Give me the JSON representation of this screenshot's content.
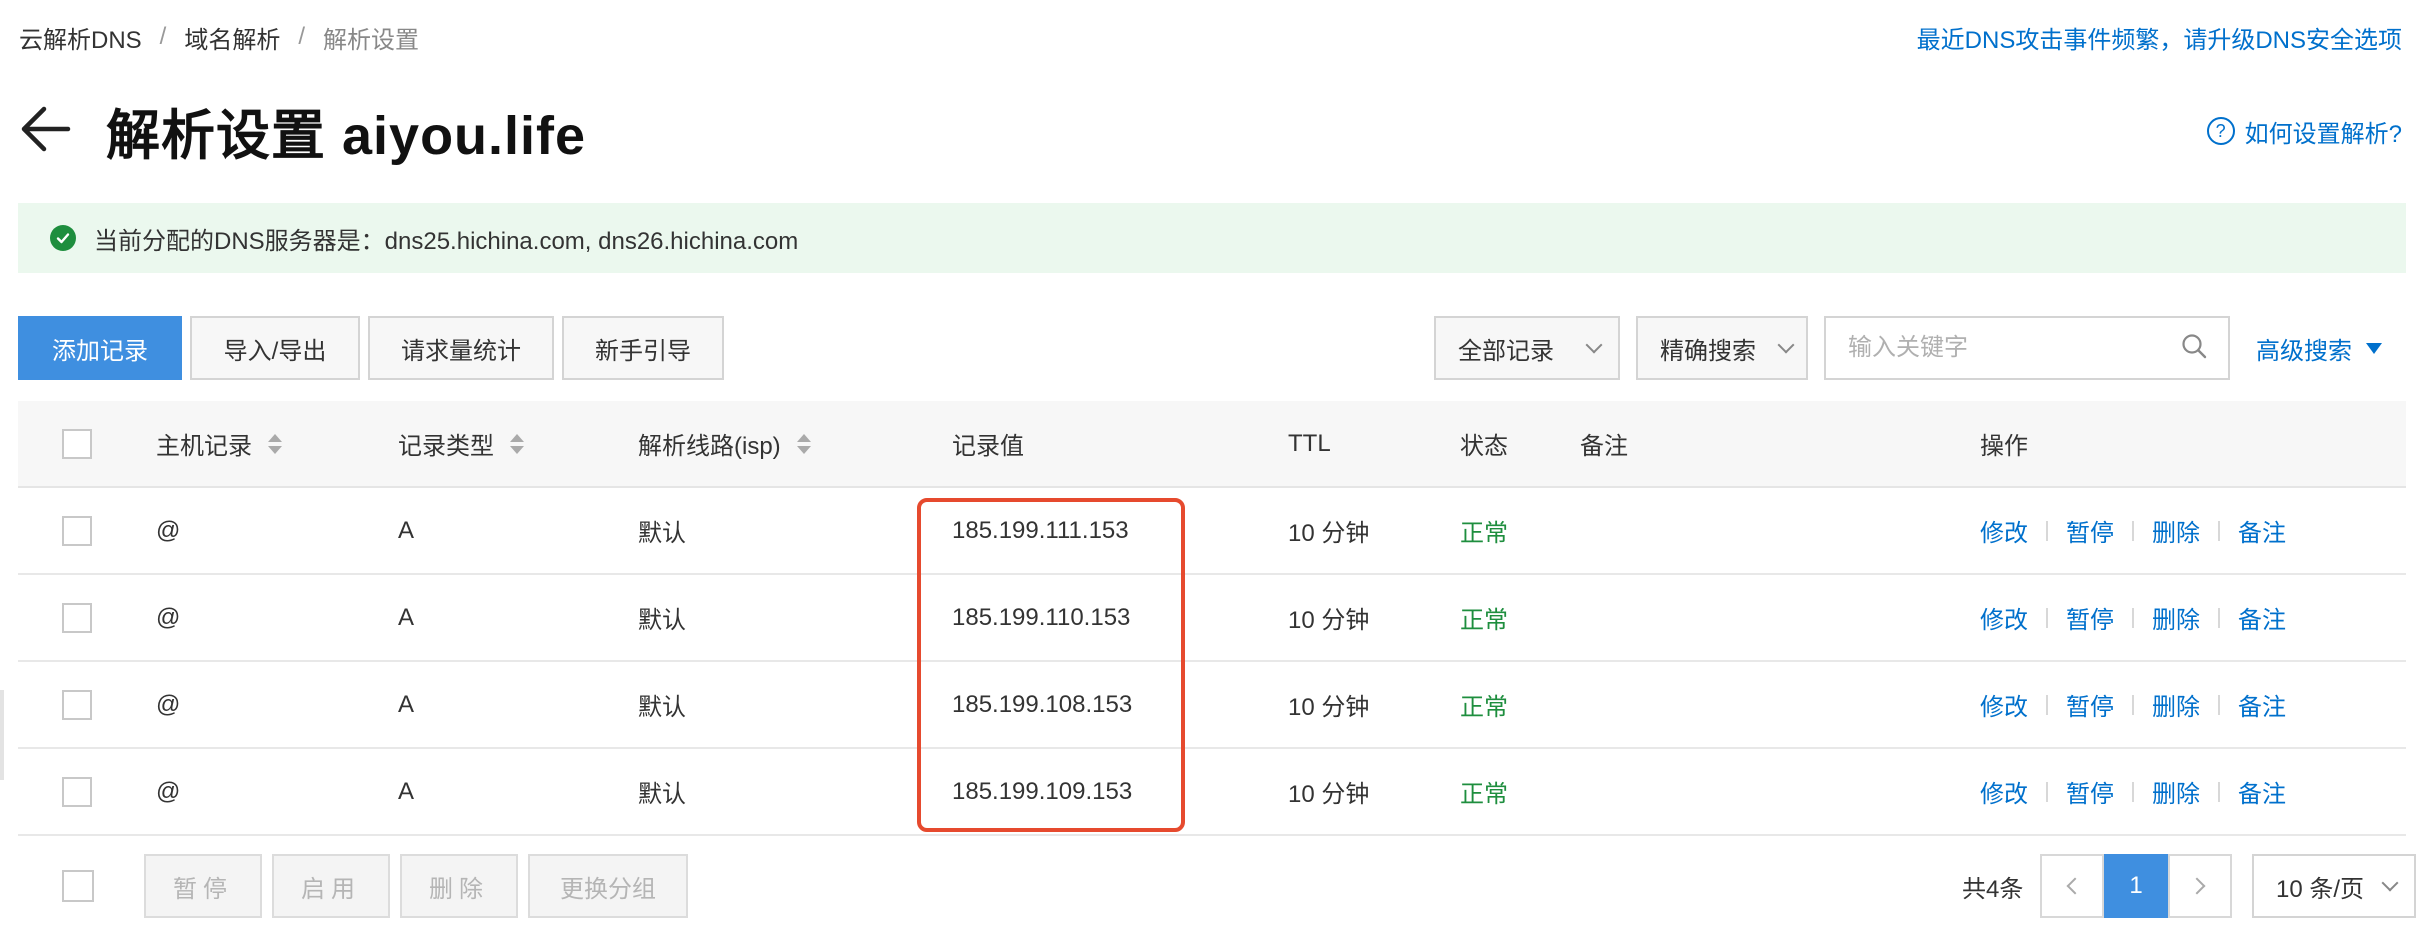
{
  "breadcrumb": {
    "items": [
      "云解析DNS",
      "域名解析",
      "解析设置"
    ],
    "separator": "/"
  },
  "notice_link": "最近DNS攻击事件频繁，请升级DNS安全选项",
  "header": {
    "title": "解析设置 aiyou.life",
    "help_label": "如何设置解析?"
  },
  "banner": {
    "text": "当前分配的DNS服务器是：dns25.hichina.com, dns26.hichina.com"
  },
  "toolbar": {
    "add_label": "添加记录",
    "import_export_label": "导入/导出",
    "stats_label": "请求量统计",
    "guide_label": "新手引导",
    "filter_value": "全部记录",
    "search_mode_value": "精确搜索",
    "search_placeholder": "输入关键字",
    "advanced_label": "高级搜索"
  },
  "table": {
    "columns": [
      "主机记录",
      "记录类型",
      "解析线路(isp)",
      "记录值",
      "TTL",
      "状态",
      "备注",
      "操作"
    ],
    "rows": [
      {
        "host": "@",
        "type": "A",
        "line": "默认",
        "value": "185.199.111.153",
        "ttl": "10 分钟",
        "status": "正常",
        "note": ""
      },
      {
        "host": "@",
        "type": "A",
        "line": "默认",
        "value": "185.199.110.153",
        "ttl": "10 分钟",
        "status": "正常",
        "note": ""
      },
      {
        "host": "@",
        "type": "A",
        "line": "默认",
        "value": "185.199.108.153",
        "ttl": "10 分钟",
        "status": "正常",
        "note": ""
      },
      {
        "host": "@",
        "type": "A",
        "line": "默认",
        "value": "185.199.109.153",
        "ttl": "10 分钟",
        "status": "正常",
        "note": ""
      }
    ],
    "actions": [
      "修改",
      "暂停",
      "删除",
      "备注"
    ]
  },
  "footer": {
    "pause_label": "暂停",
    "enable_label": "启用",
    "delete_label": "删除",
    "group_label": "更换分组",
    "total_text": "共4条",
    "current_page": "1",
    "page_size": "10 条/页"
  },
  "colors": {
    "accent": "#3f8fe0",
    "link": "#0070cc",
    "status_ok": "#1e8e3e",
    "highlight": "#e64a2e",
    "banner_bg": "#ebf8ee"
  }
}
